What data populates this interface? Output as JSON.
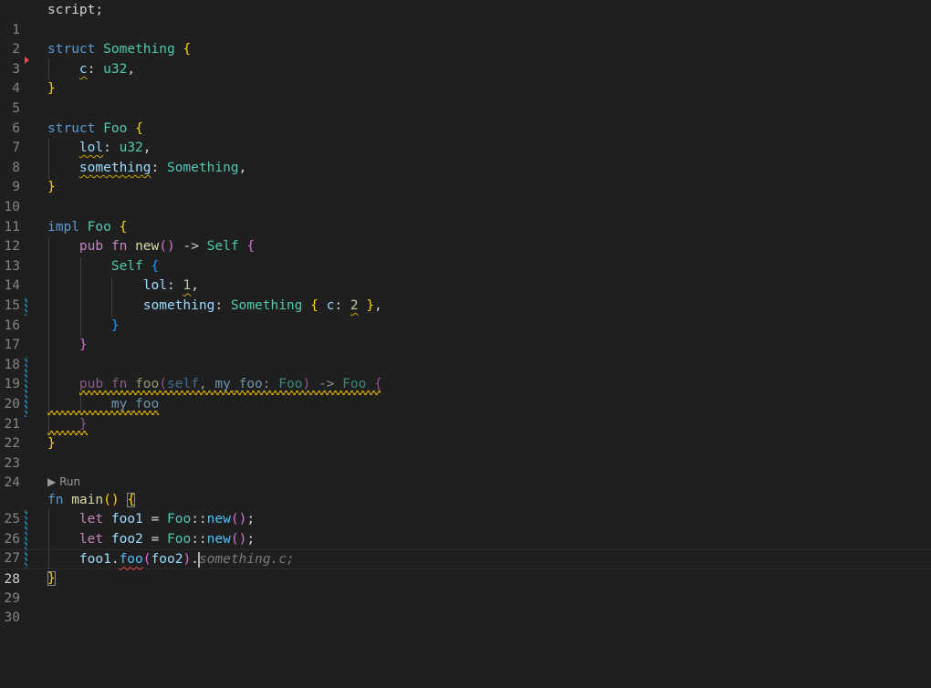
{
  "editor": {
    "line_numbers": [
      "1",
      "2",
      "3",
      "4",
      "5",
      "6",
      "7",
      "8",
      "9",
      "10",
      "11",
      "12",
      "13",
      "14",
      "15",
      "16",
      "17",
      "18",
      "19",
      "20",
      "21",
      "22",
      "23",
      "24",
      "25",
      "26",
      "27",
      "28",
      "29",
      "30"
    ],
    "codelens_run": "Run",
    "tokens": {
      "l1": [
        "script;"
      ],
      "l3": [
        "struct",
        " ",
        "Something",
        " ",
        "{"
      ],
      "l4": [
        "    ",
        "c",
        ": ",
        "u32",
        ","
      ],
      "l5": [
        "}"
      ],
      "l7": [
        "struct",
        " ",
        "Foo",
        " ",
        "{"
      ],
      "l8": [
        "    ",
        "lol",
        ": ",
        "u32",
        ","
      ],
      "l9": [
        "    ",
        "something",
        ": ",
        "Something",
        ","
      ],
      "l10": [
        "}"
      ],
      "l12": [
        "impl",
        " ",
        "Foo",
        " ",
        "{"
      ],
      "l13": [
        "    ",
        "pub",
        " ",
        "fn",
        " ",
        "new",
        "()",
        " -> ",
        "Self",
        " ",
        "{"
      ],
      "l14": [
        "        ",
        "Self",
        " ",
        "{"
      ],
      "l15": [
        "            ",
        "lol",
        ": ",
        "1",
        ","
      ],
      "l16": [
        "            ",
        "something",
        ": ",
        "Something",
        " ",
        "{",
        " ",
        "c",
        ": ",
        "2",
        " ",
        "}",
        ","
      ],
      "l17": [
        "        ",
        "}"
      ],
      "l18": [
        "    ",
        "}"
      ],
      "l20": [
        "    ",
        "pub",
        " ",
        "fn",
        " ",
        "foo",
        "(",
        "self",
        ", ",
        "my_foo",
        ": ",
        "Foo",
        ")",
        " -> ",
        "Foo",
        " ",
        "{"
      ],
      "l21": [
        "        ",
        "my_foo"
      ],
      "l22": [
        "    ",
        "}"
      ],
      "l23": [
        "}"
      ],
      "l25": [
        "fn",
        " ",
        "main",
        "()",
        " ",
        "{"
      ],
      "l26": [
        "    ",
        "let",
        " ",
        "foo1",
        " = ",
        "Foo",
        "::",
        "new",
        "()",
        ";"
      ],
      "l27": [
        "    ",
        "let",
        " ",
        "foo2",
        " = ",
        "Foo",
        "::",
        "new",
        "()",
        ";"
      ],
      "l28": [
        "    ",
        "foo1",
        ".",
        "foo",
        "(",
        "foo2",
        ")",
        ".",
        "something.c;"
      ],
      "l29": [
        "}"
      ]
    },
    "current_line": "28",
    "colors": {
      "background": "#1f1f1f",
      "keyword": "#c586c0",
      "type": "#4ec9b0",
      "function": "#dcdcaa",
      "variable": "#9cdcfe",
      "bracket_gold": "#ffd700",
      "bracket_orchid": "#da70d6",
      "bracket_blue": "#179fff",
      "warning": "#cca700",
      "error": "#f14c4c",
      "git_modified": "#1b81a8"
    },
    "icons": [
      "play-icon",
      "breakpoint-arrow-icon"
    ]
  }
}
